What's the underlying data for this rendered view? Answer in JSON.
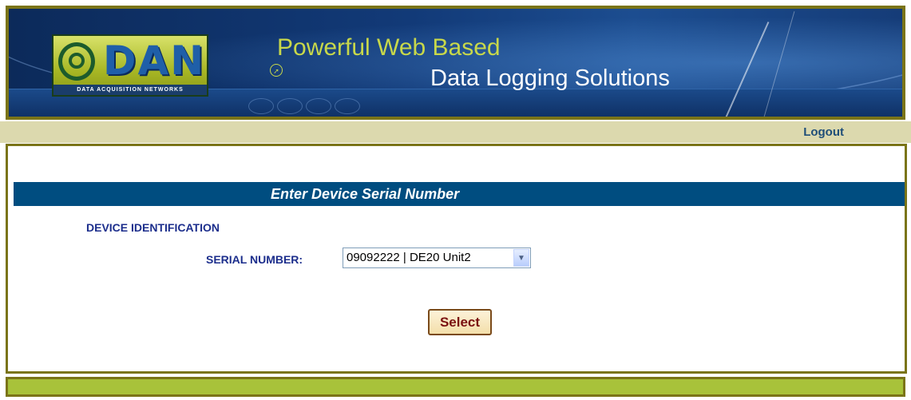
{
  "header": {
    "logo_text": "DAN",
    "logo_subtitle": "DATA ACQUISITION NETWORKS",
    "headline_line1": "Powerful Web Based",
    "headline_line2": "Data Logging Solutions"
  },
  "nav": {
    "logout_label": "Logout"
  },
  "form": {
    "title": "Enter Device Serial Number",
    "section_label": "DEVICE IDENTIFICATION",
    "serial_label": "SERIAL NUMBER:",
    "serial_selected": "09092222 | DE20 Unit2",
    "submit_label": "Select"
  },
  "colors": {
    "title_bar": "#004d80",
    "border": "#7a7418",
    "logout_bar": "#dcd9ae",
    "footer_bar": "#a8c23a",
    "label_text": "#1c2e8c"
  },
  "icons": {
    "dropdown": "chevron-down-icon",
    "logo_mark": "signal-waves-icon"
  }
}
